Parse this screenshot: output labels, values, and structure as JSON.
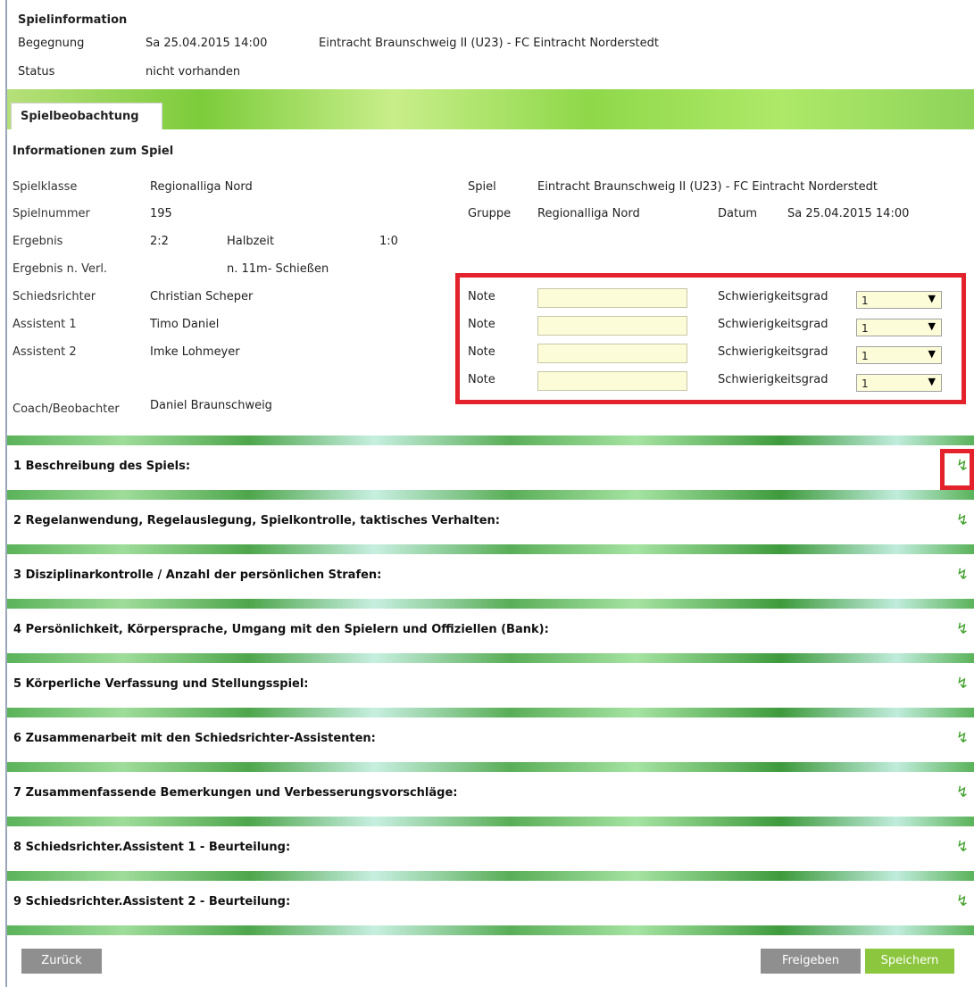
{
  "spielinfo": {
    "heading": "Spielinformation",
    "begegnung_label": "Begegnung",
    "begegnung_date": "Sa 25.04.2015 14:00",
    "begegnung_teams": "Eintracht Braunschweig II (U23) - FC Eintracht Norderstedt",
    "status_label": "Status",
    "status_value": "nicht vorhanden"
  },
  "tab": {
    "label": "Spielbeobachtung"
  },
  "info": {
    "heading": "Informationen zum Spiel",
    "spielklasse_label": "Spielklasse",
    "spielklasse_value": "Regionalliga Nord",
    "spielnummer_label": "Spielnummer",
    "spielnummer_value": "195",
    "ergebnis_label": "Ergebnis",
    "ergebnis_value": "2:2",
    "halbzeit_label": "Halbzeit",
    "halbzeit_value": "1:0",
    "ergebnis_verl_label": "Ergebnis n. Verl.",
    "elfmeter_label": "n. 11m- Schießen",
    "schiedsrichter_label": "Schiedsrichter",
    "schiedsrichter_value": "Christian Scheper",
    "assistent1_label": "Assistent 1",
    "assistent1_value": "Timo Daniel",
    "assistent2_label": "Assistent 2",
    "assistent2_value": "Imke Lohmeyer",
    "coach_label": "Coach/Beobachter",
    "coach_value": "Daniel  Braunschweig",
    "spiel_label": "Spiel",
    "spiel_value": "Eintracht Braunschweig II (U23) - FC Eintracht Norderstedt",
    "gruppe_label": "Gruppe",
    "gruppe_value": "Regionalliga Nord",
    "datum_label": "Datum",
    "datum_value": "Sa  25.04.2015 14:00"
  },
  "ratings": [
    {
      "note_label": "Note",
      "note_value": "",
      "grad_label": "Schwierigkeitsgrad",
      "grad_value": "1"
    },
    {
      "note_label": "Note",
      "note_value": "",
      "grad_label": "Schwierigkeitsgrad",
      "grad_value": "1"
    },
    {
      "note_label": "Note",
      "note_value": "",
      "grad_label": "Schwierigkeitsgrad",
      "grad_value": "1"
    },
    {
      "note_label": "Note",
      "note_value": "",
      "grad_label": "Schwierigkeitsgrad",
      "grad_value": "1"
    }
  ],
  "sections": [
    {
      "title": "1 Beschreibung des Spiels:"
    },
    {
      "title": "2 Regelanwendung, Regelauslegung, Spielkontrolle, taktisches Verhalten:"
    },
    {
      "title": "3 Disziplinarkontrolle / Anzahl der persönlichen Strafen:"
    },
    {
      "title": "4 Persönlichkeit, Körpersprache, Umgang mit den Spielern und Offiziellen (Bank):"
    },
    {
      "title": "5 Körperliche Verfassung und Stellungsspiel:"
    },
    {
      "title": "6 Zusammenarbeit mit den Schiedsrichter-Assistenten:"
    },
    {
      "title": "7 Zusammenfassende Bemerkungen und Verbesserungsvorschläge:"
    },
    {
      "title": "8 Schiedsrichter.Assistent 1 - Beurteilung:"
    },
    {
      "title": "9 Schiedsrichter.Assistent 2 - Beurteilung:"
    }
  ],
  "buttons": {
    "back": "Zurück",
    "release": "Freigeben",
    "save": "Speichern"
  },
  "colors": {
    "highlight_red": "#e3222c",
    "save_green": "#8cc63e",
    "neutral_gray": "#8f8f8f",
    "input_bg": "#fdfcd8"
  },
  "icons": {
    "section_expand": "expand-arrow-icon",
    "select_arrow": "dropdown-arrow-icon"
  }
}
